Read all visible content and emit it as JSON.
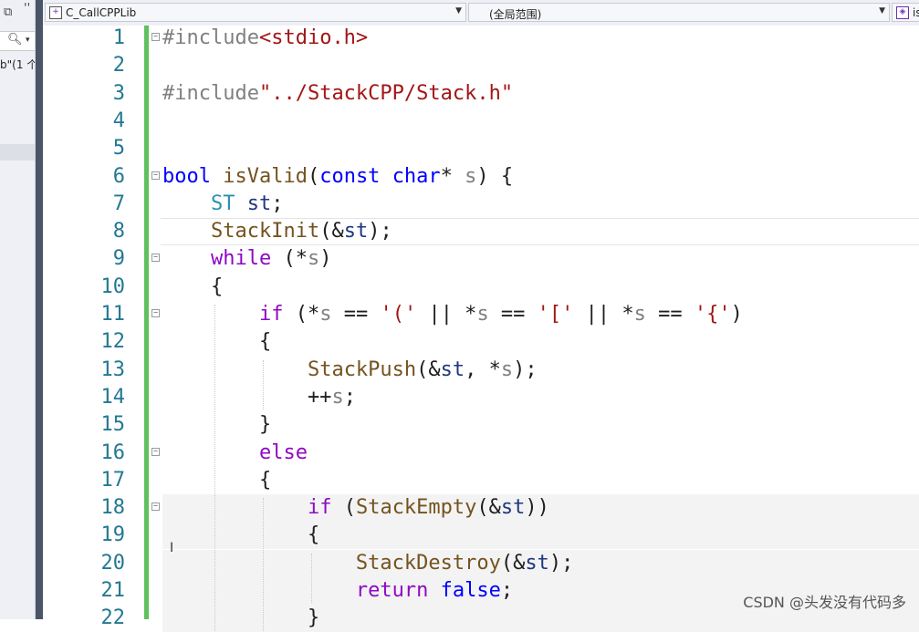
{
  "left_panel": {
    "icon_top_left": "restore-window-icon",
    "top_label": "''",
    "search_icon": "search-icon",
    "search_dropdown": "▾",
    "info_text": "b\"(1 个"
  },
  "navbar": {
    "project_dropdown": {
      "icon": "project-icon",
      "label": "C_CallCPPLib"
    },
    "scope_dropdown": {
      "label": "(全局范围)"
    },
    "member_dropdown": {
      "icon": "member-icon",
      "label": "is"
    }
  },
  "editor": {
    "lines": [
      {
        "num": "1",
        "tokens": [
          {
            "t": "#include",
            "c": "pp"
          },
          {
            "t": "<stdio.h>",
            "c": "str"
          }
        ]
      },
      {
        "num": "2",
        "tokens": []
      },
      {
        "num": "3",
        "tokens": [
          {
            "t": "#include",
            "c": "pp"
          },
          {
            "t": "\"../StackCPP/Stack.h\"",
            "c": "str"
          }
        ]
      },
      {
        "num": "4",
        "tokens": []
      },
      {
        "num": "5",
        "tokens": []
      },
      {
        "num": "6",
        "tokens": [
          {
            "t": "bool",
            "c": "kw"
          },
          {
            "t": " ",
            "c": "plain"
          },
          {
            "t": "isValid",
            "c": "fn"
          },
          {
            "t": "(",
            "c": "plain"
          },
          {
            "t": "const",
            "c": "kw"
          },
          {
            "t": " ",
            "c": "plain"
          },
          {
            "t": "char",
            "c": "kw"
          },
          {
            "t": "* ",
            "c": "plain"
          },
          {
            "t": "s",
            "c": "par"
          },
          {
            "t": ") {",
            "c": "plain"
          }
        ]
      },
      {
        "num": "7",
        "tokens": [
          {
            "t": "    ",
            "c": "plain"
          },
          {
            "t": "ST",
            "c": "ty"
          },
          {
            "t": " ",
            "c": "plain"
          },
          {
            "t": "st",
            "c": "var"
          },
          {
            "t": ";",
            "c": "plain"
          }
        ]
      },
      {
        "num": "8",
        "tokens": [
          {
            "t": "    ",
            "c": "plain"
          },
          {
            "t": "StackInit",
            "c": "fn"
          },
          {
            "t": "(&",
            "c": "plain"
          },
          {
            "t": "st",
            "c": "var"
          },
          {
            "t": ");",
            "c": "plain"
          }
        ]
      },
      {
        "num": "9",
        "tokens": [
          {
            "t": "    ",
            "c": "plain"
          },
          {
            "t": "while",
            "c": "ctl"
          },
          {
            "t": " (*",
            "c": "plain"
          },
          {
            "t": "s",
            "c": "par"
          },
          {
            "t": ")",
            "c": "plain"
          }
        ]
      },
      {
        "num": "10",
        "tokens": [
          {
            "t": "    {",
            "c": "plain"
          }
        ]
      },
      {
        "num": "11",
        "tokens": [
          {
            "t": "        ",
            "c": "plain"
          },
          {
            "t": "if",
            "c": "ctl"
          },
          {
            "t": " (*",
            "c": "plain"
          },
          {
            "t": "s",
            "c": "par"
          },
          {
            "t": " == ",
            "c": "plain"
          },
          {
            "t": "'('",
            "c": "str"
          },
          {
            "t": " || *",
            "c": "plain"
          },
          {
            "t": "s",
            "c": "par"
          },
          {
            "t": " == ",
            "c": "plain"
          },
          {
            "t": "'['",
            "c": "str"
          },
          {
            "t": " || *",
            "c": "plain"
          },
          {
            "t": "s",
            "c": "par"
          },
          {
            "t": " == ",
            "c": "plain"
          },
          {
            "t": "'{'",
            "c": "str"
          },
          {
            "t": ")",
            "c": "plain"
          }
        ]
      },
      {
        "num": "12",
        "tokens": [
          {
            "t": "        {",
            "c": "plain"
          }
        ]
      },
      {
        "num": "13",
        "tokens": [
          {
            "t": "            ",
            "c": "plain"
          },
          {
            "t": "StackPush",
            "c": "fn"
          },
          {
            "t": "(&",
            "c": "plain"
          },
          {
            "t": "st",
            "c": "var"
          },
          {
            "t": ", *",
            "c": "plain"
          },
          {
            "t": "s",
            "c": "par"
          },
          {
            "t": ");",
            "c": "plain"
          }
        ]
      },
      {
        "num": "14",
        "tokens": [
          {
            "t": "            ++",
            "c": "plain"
          },
          {
            "t": "s",
            "c": "par"
          },
          {
            "t": ";",
            "c": "plain"
          }
        ]
      },
      {
        "num": "15",
        "tokens": [
          {
            "t": "        }",
            "c": "plain"
          }
        ]
      },
      {
        "num": "16",
        "tokens": [
          {
            "t": "        ",
            "c": "plain"
          },
          {
            "t": "else",
            "c": "ctl"
          }
        ]
      },
      {
        "num": "17",
        "tokens": [
          {
            "t": "        {",
            "c": "plain"
          }
        ]
      },
      {
        "num": "18",
        "tokens": [
          {
            "t": "            ",
            "c": "plain"
          },
          {
            "t": "if",
            "c": "ctl"
          },
          {
            "t": " (",
            "c": "plain"
          },
          {
            "t": "StackEmpty",
            "c": "fn"
          },
          {
            "t": "(&",
            "c": "plain"
          },
          {
            "t": "st",
            "c": "var"
          },
          {
            "t": "))",
            "c": "plain"
          }
        ]
      },
      {
        "num": "19",
        "tokens": [
          {
            "t": "            {",
            "c": "plain"
          }
        ]
      },
      {
        "num": "20",
        "tokens": [
          {
            "t": "                ",
            "c": "plain"
          },
          {
            "t": "StackDestroy",
            "c": "fn"
          },
          {
            "t": "(&",
            "c": "plain"
          },
          {
            "t": "st",
            "c": "var"
          },
          {
            "t": ");",
            "c": "plain"
          }
        ]
      },
      {
        "num": "21",
        "tokens": [
          {
            "t": "                ",
            "c": "plain"
          },
          {
            "t": "return",
            "c": "ctl"
          },
          {
            "t": " ",
            "c": "plain"
          },
          {
            "t": "false",
            "c": "kw"
          },
          {
            "t": ";",
            "c": "plain"
          }
        ]
      },
      {
        "num": "22",
        "tokens": [
          {
            "t": "            }",
            "c": "plain"
          }
        ]
      }
    ],
    "fold_markers": [
      "1",
      "6",
      "9",
      "11",
      "16",
      "18"
    ],
    "current_line": "8"
  },
  "watermark": "CSDN @头发没有代码多",
  "colors": {
    "change_bar": "#5ec15e",
    "line_number": "#237893",
    "keyword": "#0000ff",
    "control": "#8f08c4",
    "function": "#74531f",
    "type": "#2b91af",
    "variable": "#1f377f",
    "string": "#a31515",
    "preprocessor": "#808080"
  }
}
